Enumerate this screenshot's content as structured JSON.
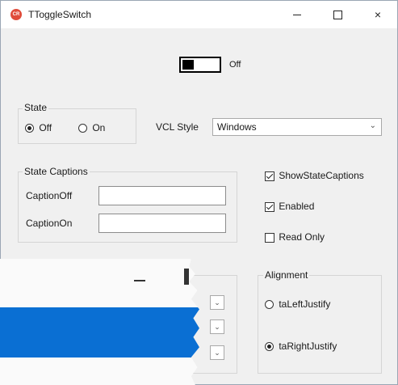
{
  "window": {
    "title": "TToggleSwitch",
    "app_icon_text": "CR",
    "close_glyph": "×"
  },
  "toggle": {
    "state": "off",
    "caption": "Off"
  },
  "state_group": {
    "label": "State",
    "options": [
      "Off",
      "On"
    ],
    "selected": "Off"
  },
  "vcl_style": {
    "label": "VCL Style",
    "value": "Windows",
    "chevron": "⌄"
  },
  "captions_group": {
    "label": "State Captions",
    "off_label": "CaptionOff",
    "on_label": "CaptionOn",
    "off_value": "",
    "on_value": ""
  },
  "checkboxes": [
    {
      "label": "ShowStateCaptions",
      "checked": true
    },
    {
      "label": "Enabled",
      "checked": true
    },
    {
      "label": "Read Only",
      "checked": false
    }
  ],
  "alignment_group": {
    "label": "Alignment",
    "options": [
      "taLeftJustify",
      "taRightJustify"
    ],
    "selected": "taRightJustify"
  },
  "colors": {
    "accent_band": "#0a6fd3",
    "window_bg": "#f0f0f0"
  }
}
